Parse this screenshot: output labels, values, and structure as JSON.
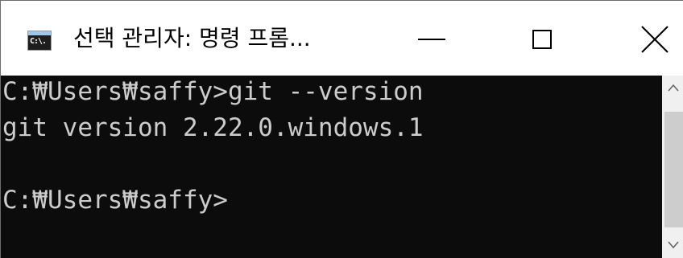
{
  "window": {
    "title": "선택 관리자: 명령 프롬...",
    "icon": "cmd-icon",
    "icon_text": "C:\\."
  },
  "controls": {
    "minimize": "minimize",
    "maximize": "maximize",
    "close": "close"
  },
  "console": {
    "lines": [
      "C:₩Users₩saffy>git --version",
      "git version 2.22.0.windows.1",
      "",
      "C:₩Users₩saffy>"
    ],
    "background": "#0c0c0c",
    "foreground": "#cccccc"
  },
  "scrollbar": {
    "up_arrow": "^",
    "down_arrow": "v"
  }
}
